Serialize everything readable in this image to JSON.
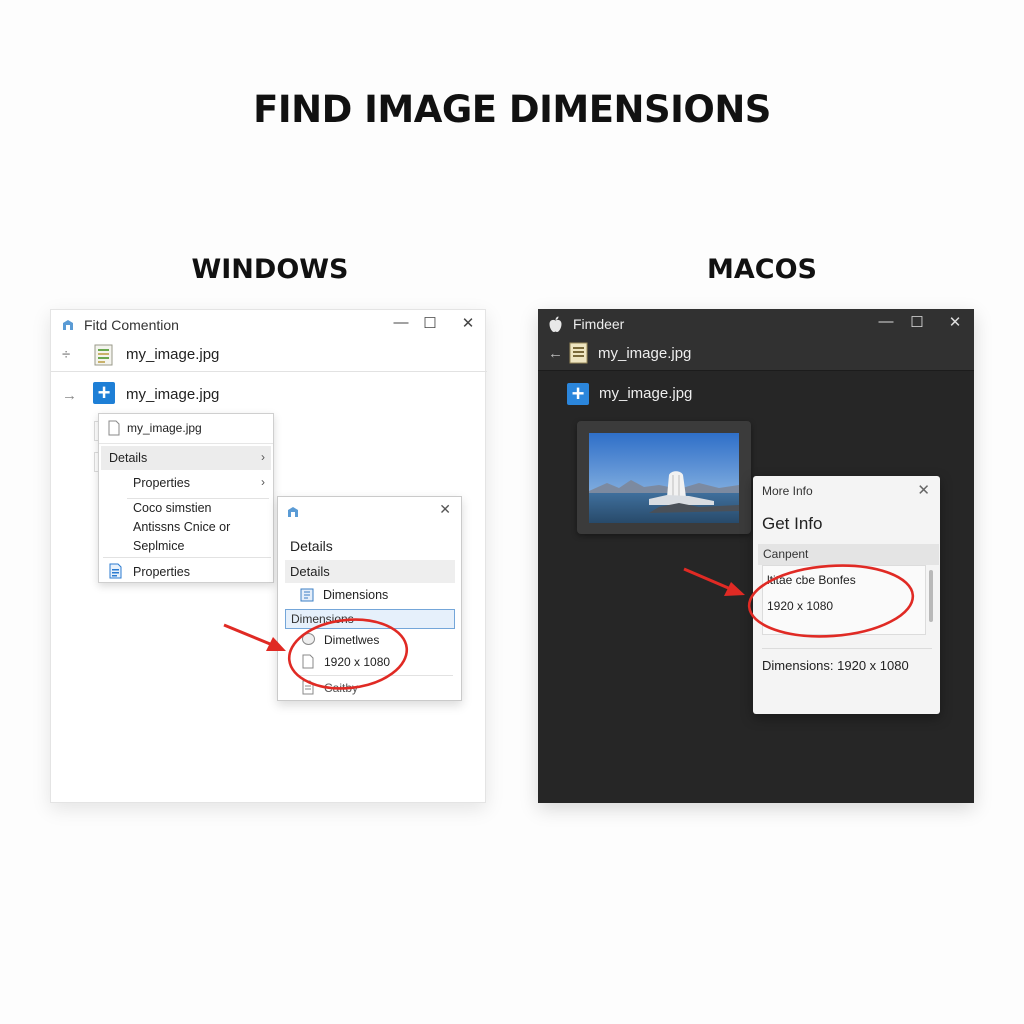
{
  "title": "FIND IMAGE DIMENSIONS",
  "windows": {
    "heading": "WINDOWS",
    "window_title": "Fitd Comention",
    "path_file": "my_image.jpg",
    "selected_file": "my_image.jpg",
    "context_menu": {
      "header": "my_image.jpg",
      "items": [
        "Details",
        "Properties"
      ],
      "description_lines": [
        "Coco simstien",
        "Antissns Cnice or",
        "Seplmice"
      ],
      "footer": "Properties"
    },
    "properties_dialog": {
      "title": "Details",
      "tab": "Details",
      "dimensions_label": "Dimensions",
      "selected_row": "Dimensions",
      "row_label": "Dimetlwes",
      "row_value": "1920 x 1080",
      "row_partial": "Caitby"
    }
  },
  "macos": {
    "heading": "MACOS",
    "window_title": "Fimdeer",
    "path_file": "my_image.jpg",
    "selected_file": "my_image.jpg",
    "info_panel": {
      "title": "More Info",
      "heading": "Get Info",
      "section": "Canpent",
      "line1": "ltitae cbe Bonfes",
      "line2": "1920 x 1080",
      "dimensions": "Dimensions: 1920 x 1080"
    }
  },
  "colors": {
    "annotation": "#e02a24",
    "mac_window": "#262626",
    "win_window": "#ffffff",
    "accent": "#1e7fd6"
  }
}
